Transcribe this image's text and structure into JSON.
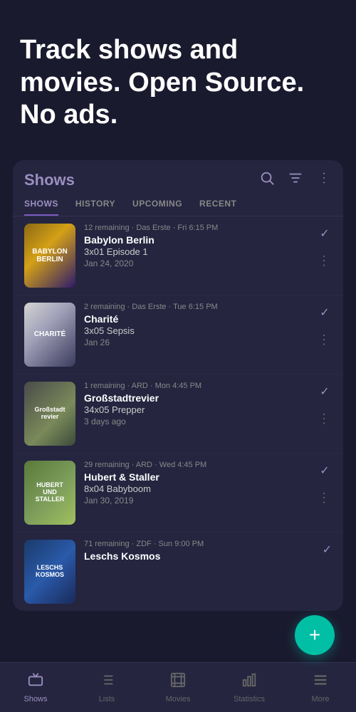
{
  "hero": {
    "title": "Track shows and movies. Open Source. No ads."
  },
  "card": {
    "title": "Shows",
    "tabs": [
      {
        "label": "SHOWS",
        "active": true
      },
      {
        "label": "HISTORY",
        "active": false
      },
      {
        "label": "UPCOMING",
        "active": false
      },
      {
        "label": "RECENT",
        "active": false
      }
    ],
    "shows": [
      {
        "id": "babylon",
        "thumb_class": "thumb-babylon",
        "thumb_text": "BABYLON\nBERLIN",
        "meta": "12 remaining · Das Erste · Fri 6:15 PM",
        "name": "Babylon Berlin",
        "episode": "3x01 Episode 1",
        "date": "Jan 24, 2020"
      },
      {
        "id": "charite",
        "thumb_class": "thumb-charite",
        "thumb_text": "CHARITÉ",
        "meta": "2 remaining · Das Erste · Tue 6:15 PM",
        "name": "Charité",
        "episode": "3x05 Sepsis",
        "date": "Jan 26"
      },
      {
        "id": "grossstadt",
        "thumb_class": "thumb-grossstadt",
        "thumb_text": "Großstadt\nrevier",
        "meta": "1 remaining · ARD · Mon 4:45 PM",
        "name": "Großstadtrevier",
        "episode": "34x05 Prepper",
        "date": "3 days ago"
      },
      {
        "id": "hubert",
        "thumb_class": "thumb-hubert",
        "thumb_text": "HUBERT\nUND\nSTALLER",
        "meta": "29 remaining · ARD · Wed 4:45 PM",
        "name": "Hubert & Staller",
        "episode": "8x04 Babyboom",
        "date": "Jan 30, 2019"
      },
      {
        "id": "leschs",
        "thumb_class": "thumb-leschs",
        "thumb_text": "LESCHS\nKOSMOS",
        "meta": "71 remaining · ZDF · Sun 9:00 PM",
        "name": "Leschs Kosmos",
        "episode": "",
        "date": ""
      }
    ]
  },
  "fab": {
    "label": "+"
  },
  "bottom_nav": {
    "items": [
      {
        "id": "shows",
        "label": "Shows",
        "active": true,
        "icon": "tv"
      },
      {
        "id": "lists",
        "label": "Lists",
        "active": false,
        "icon": "list"
      },
      {
        "id": "movies",
        "label": "Movies",
        "active": false,
        "icon": "film"
      },
      {
        "id": "statistics",
        "label": "Statistics",
        "active": false,
        "icon": "bar-chart"
      },
      {
        "id": "more",
        "label": "More",
        "active": false,
        "icon": "more-horiz"
      }
    ]
  }
}
